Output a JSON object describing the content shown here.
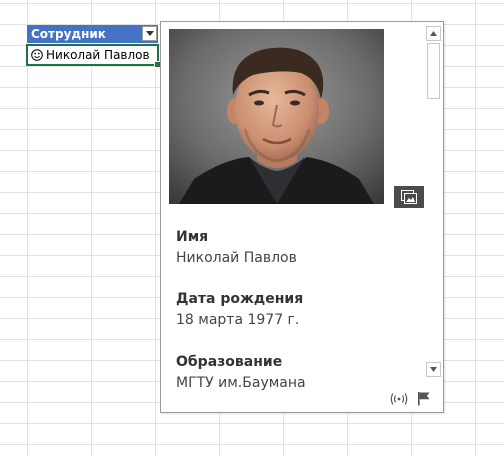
{
  "sheet": {
    "header_cell": "Сотрудник",
    "data_cell": "Николай Павлов",
    "data_cell_icon": "smiley-icon",
    "filter_icon": "dropdown-arrow-icon"
  },
  "card": {
    "photo_alt": "photo",
    "fields": [
      {
        "label": "Имя",
        "value": "Николай Павлов"
      },
      {
        "label": "Дата рождения",
        "value": "18 марта 1977 г."
      },
      {
        "label": "Образование",
        "value": "МГТУ им.Баумана"
      }
    ],
    "footer_icons": [
      "broadcast-icon",
      "flag-icon"
    ],
    "image_button_icon": "image-gallery-icon"
  },
  "colors": {
    "header_bg": "#4472c4",
    "selection_border": "#217346",
    "grid": "#e2e2e2"
  }
}
